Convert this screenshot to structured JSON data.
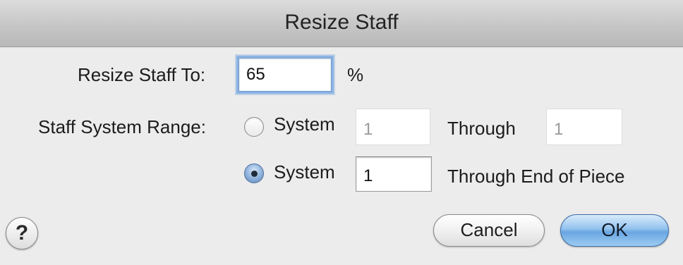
{
  "dialog": {
    "title": "Resize Staff"
  },
  "resize": {
    "label": "Resize Staff To:",
    "value": "65",
    "unit": "%"
  },
  "range": {
    "label": "Staff System Range:",
    "option1": {
      "label": "System",
      "from_value": "1",
      "through_label": "Through",
      "through_value": "1",
      "selected": false
    },
    "option2": {
      "label": "System",
      "from_value": "1",
      "through_label": "Through End of Piece",
      "selected": true
    }
  },
  "buttons": {
    "help": "?",
    "cancel": "Cancel",
    "ok": "OK"
  },
  "icons": {
    "help": "help-icon"
  }
}
